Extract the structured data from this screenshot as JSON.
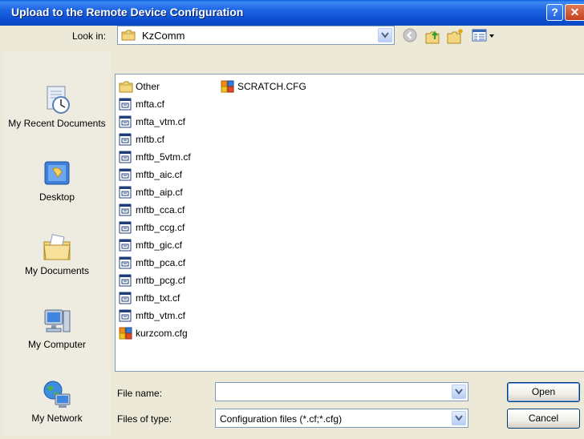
{
  "window": {
    "title": "Upload to the Remote Device Configuration",
    "help_label": "?",
    "close_label": "✕"
  },
  "toolbar": {
    "look_in_label": "Look in:",
    "look_in_value": "KzComm",
    "icons": [
      "back-arrow-icon",
      "up-one-level-icon",
      "new-folder-icon",
      "views-menu-icon"
    ]
  },
  "places": [
    {
      "label": "My Recent Documents",
      "icon": "recent-documents-icon"
    },
    {
      "label": "Desktop",
      "icon": "desktop-icon"
    },
    {
      "label": "My Documents",
      "icon": "my-documents-icon"
    },
    {
      "label": "My Computer",
      "icon": "my-computer-icon"
    },
    {
      "label": "My Network",
      "icon": "my-network-icon"
    }
  ],
  "files": [
    {
      "name": "Other",
      "type": "folder"
    },
    {
      "name": "mfta.cf",
      "type": "cf"
    },
    {
      "name": "mfta_vtm.cf",
      "type": "cf"
    },
    {
      "name": "mftb.cf",
      "type": "cf"
    },
    {
      "name": "mftb_5vtm.cf",
      "type": "cf"
    },
    {
      "name": "mftb_aic.cf",
      "type": "cf"
    },
    {
      "name": "mftb_aip.cf",
      "type": "cf"
    },
    {
      "name": "mftb_cca.cf",
      "type": "cf"
    },
    {
      "name": "mftb_ccg.cf",
      "type": "cf"
    },
    {
      "name": "mftb_gic.cf",
      "type": "cf"
    },
    {
      "name": "mftb_pca.cf",
      "type": "cf"
    },
    {
      "name": "mftb_pcg.cf",
      "type": "cf"
    },
    {
      "name": "mftb_txt.cf",
      "type": "cf"
    },
    {
      "name": "mftb_vtm.cf",
      "type": "cf"
    },
    {
      "name": "kurzcom.cfg",
      "type": "cfg"
    },
    {
      "name": "SCRATCH.CFG",
      "type": "cfg"
    }
  ],
  "form": {
    "file_name_label": "File name:",
    "file_name_value": "",
    "file_type_label": "Files of type:",
    "file_type_value": "Configuration files (*.cf;*.cfg)"
  },
  "buttons": {
    "open_label": "Open",
    "cancel_label": "Cancel"
  },
  "colors": {
    "titlebar": "#0a50d2",
    "dialog_bg": "#ece9d8",
    "places_bg": "#eeece0",
    "field_border": "#7f9db9"
  }
}
